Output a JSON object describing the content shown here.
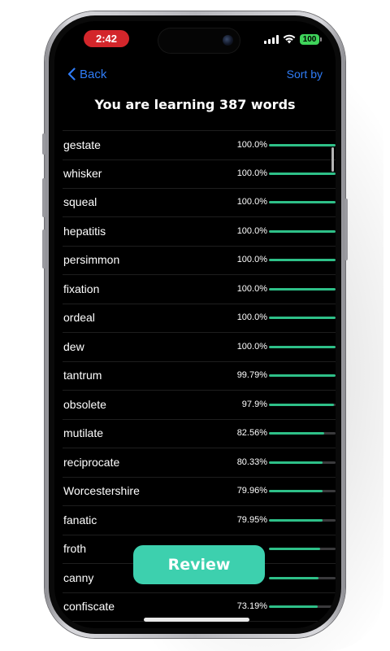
{
  "status_bar": {
    "time": "2:42",
    "battery": "100",
    "icons": [
      "signal-icon",
      "wifi-icon",
      "battery-icon"
    ]
  },
  "nav": {
    "back_label": "Back",
    "sort_label": "Sort by",
    "back_icon": "chevron-left-icon"
  },
  "header": {
    "title": "You are learning 387 words"
  },
  "words": [
    {
      "word": "gestate",
      "percent": "100.0%",
      "progress": 1.0
    },
    {
      "word": "whisker",
      "percent": "100.0%",
      "progress": 1.0
    },
    {
      "word": "squeal",
      "percent": "100.0%",
      "progress": 1.0
    },
    {
      "word": "hepatitis",
      "percent": "100.0%",
      "progress": 1.0
    },
    {
      "word": "persimmon",
      "percent": "100.0%",
      "progress": 1.0
    },
    {
      "word": "fixation",
      "percent": "100.0%",
      "progress": 1.0
    },
    {
      "word": "ordeal",
      "percent": "100.0%",
      "progress": 1.0
    },
    {
      "word": "dew",
      "percent": "100.0%",
      "progress": 1.0
    },
    {
      "word": "tantrum",
      "percent": "99.79%",
      "progress": 0.9979
    },
    {
      "word": "obsolete",
      "percent": "97.9%",
      "progress": 0.979
    },
    {
      "word": "mutilate",
      "percent": "82.56%",
      "progress": 0.8256
    },
    {
      "word": "reciprocate",
      "percent": "80.33%",
      "progress": 0.8033
    },
    {
      "word": "Worcestershire",
      "percent": "79.96%",
      "progress": 0.7996
    },
    {
      "word": "fanatic",
      "percent": "79.95%",
      "progress": 0.7995
    },
    {
      "word": "froth",
      "percent": "",
      "progress": 0.77
    },
    {
      "word": "canny",
      "percent": "",
      "progress": 0.74
    },
    {
      "word": "confiscate",
      "percent": "73.19%",
      "progress": 0.7319
    }
  ],
  "review_button": {
    "label": "Review"
  },
  "colors": {
    "accent_blue": "#2f7cf6",
    "progress_green": "#2ec088",
    "review_teal": "#3dd0ae",
    "time_pill_red": "#d3262b",
    "battery_green": "#3fd35a"
  }
}
